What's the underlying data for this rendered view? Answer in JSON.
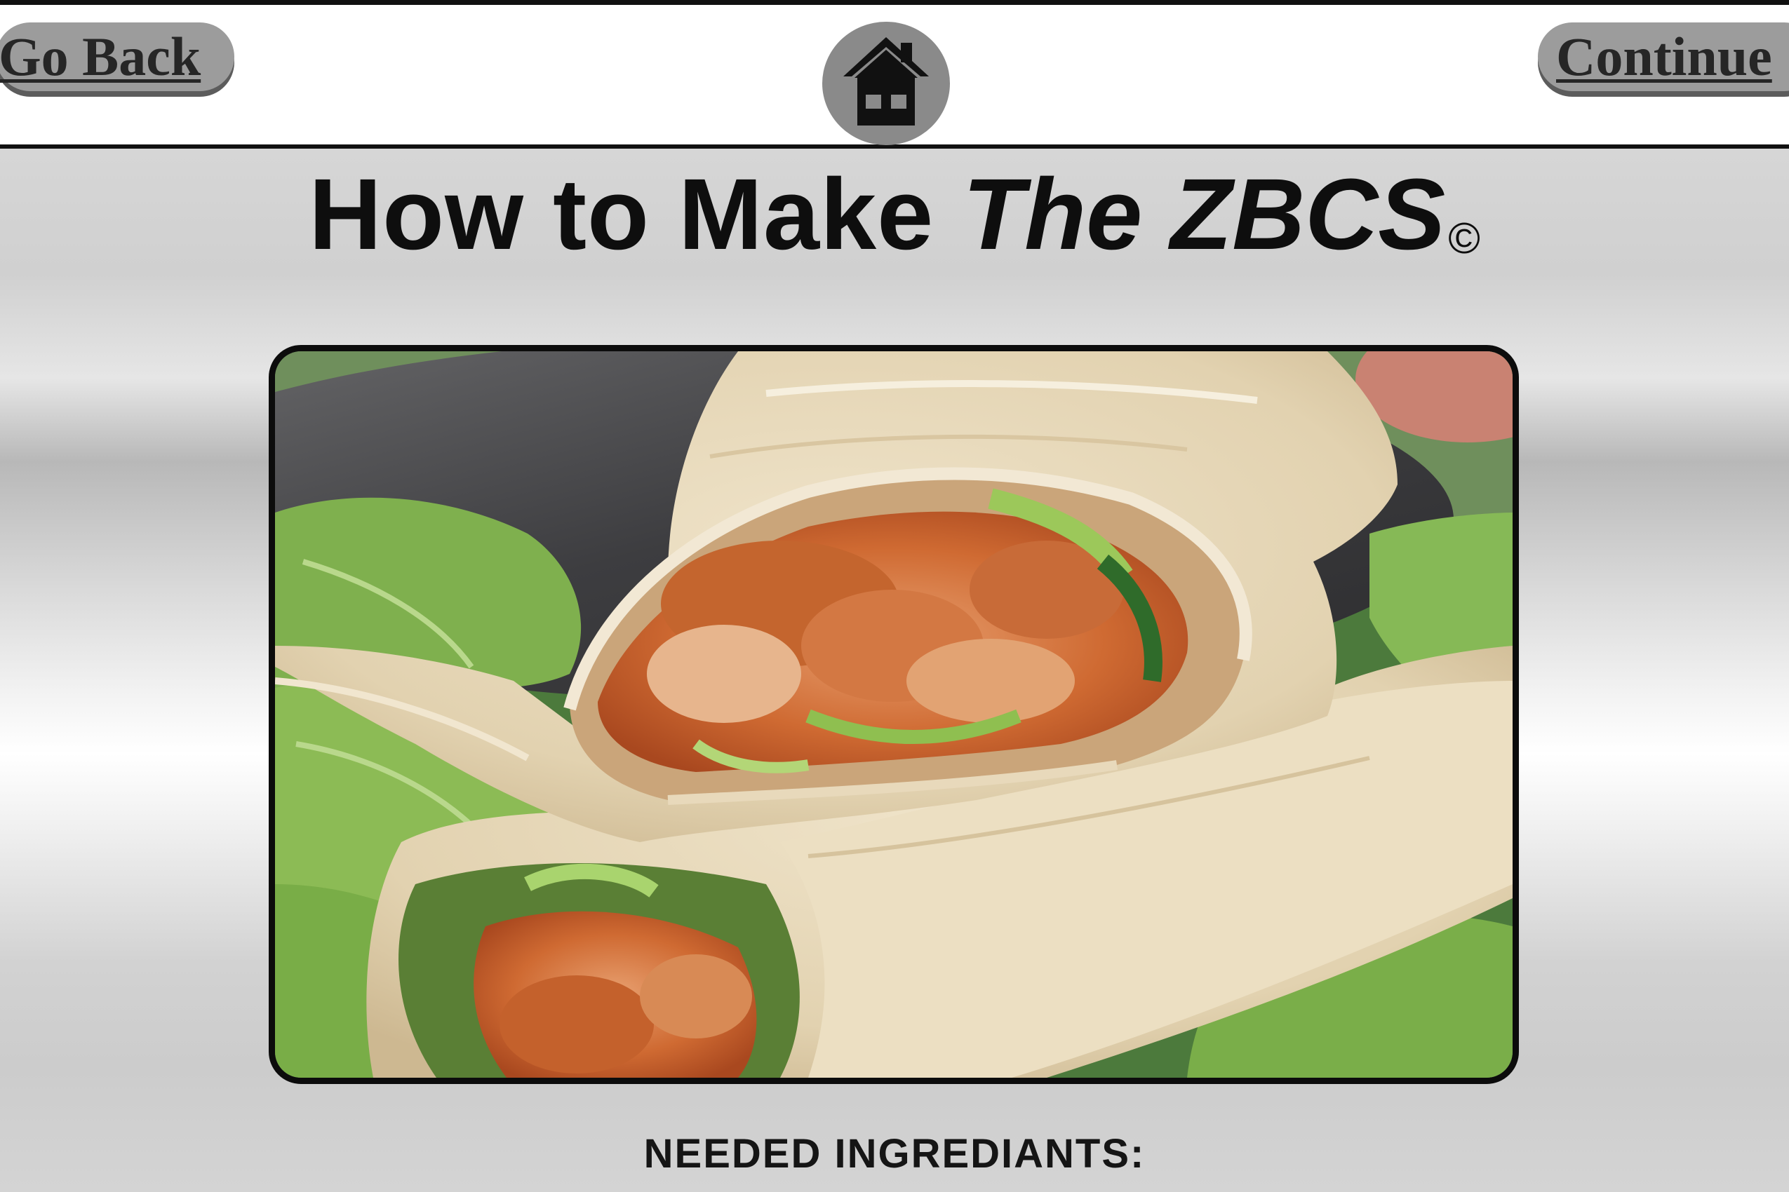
{
  "nav": {
    "back_label": "Go Back",
    "continue_label": "Continue",
    "home_icon": "house-icon"
  },
  "header": {
    "title_plain": "How to Make ",
    "title_italic": "The ZBCS",
    "title_mark": "©"
  },
  "hero_image": {
    "subject": "chicken wrap with lettuce"
  },
  "section": {
    "ingredients_heading": "NEEDED INGREDIANTS:"
  },
  "colors": {
    "nav_button": "#9c9c9c",
    "nav_button_shadow": "#5c5c5c",
    "home_circle": "#8a8a8a",
    "frame_border": "#0c0c0c",
    "text": "#0e0e0e"
  }
}
